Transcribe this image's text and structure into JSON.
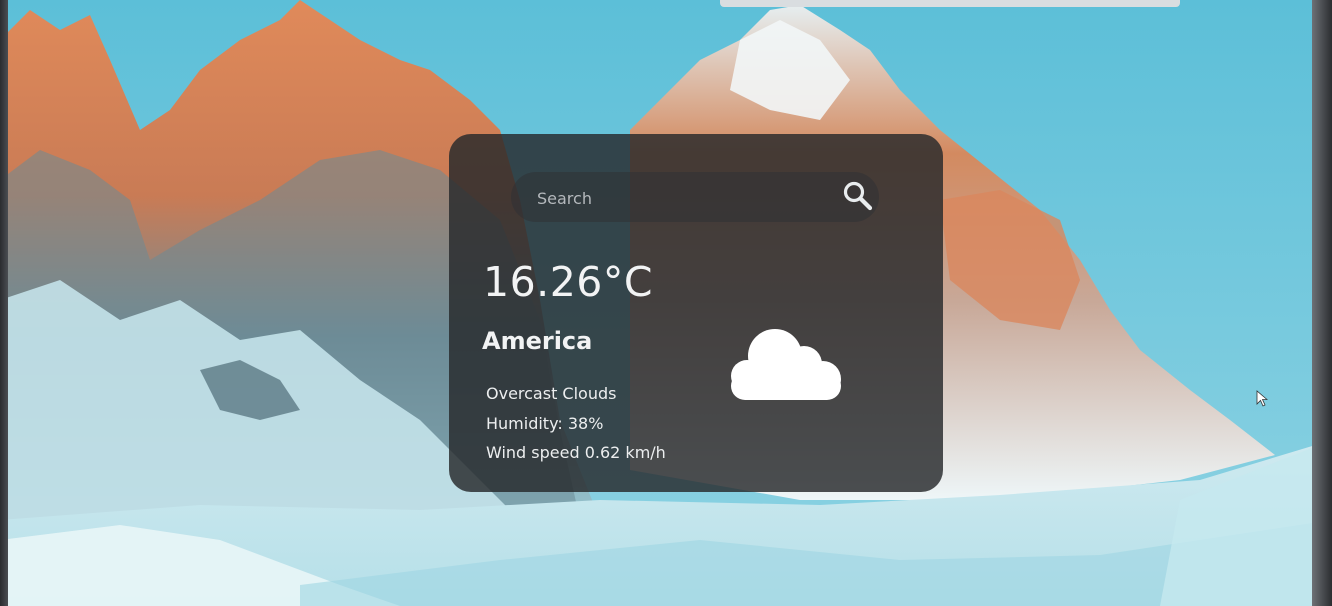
{
  "search": {
    "placeholder": "Search",
    "value": "",
    "icon": "search-icon"
  },
  "weather": {
    "temperature": "16.26°C",
    "city": "America",
    "description": "Overcast Clouds",
    "humidity": "Humidity: 38%",
    "wind": "Wind speed 0.62 km/h",
    "icon": "cloud-icon"
  },
  "colors": {
    "card_background": "#26282b",
    "text": "#f2f3f4",
    "cloud": "#ffffff",
    "sky": "#6cc7dd"
  }
}
